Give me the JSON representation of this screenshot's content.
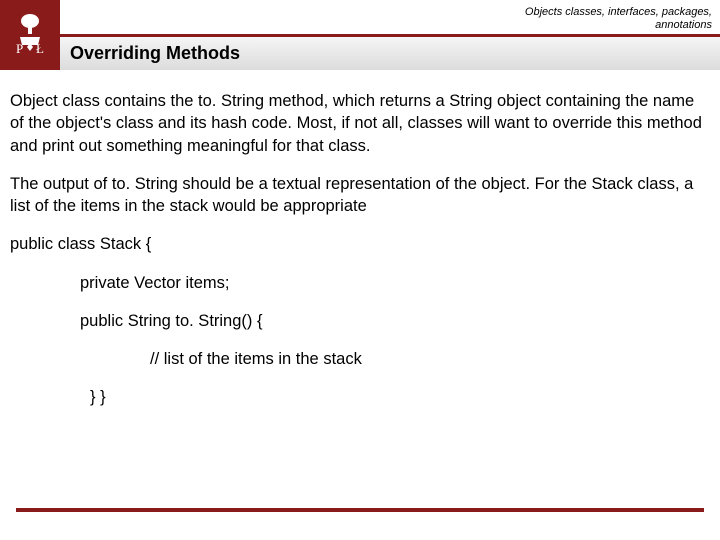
{
  "colors": {
    "accent": "#8a1b1b"
  },
  "header": {
    "logo_letters": {
      "left": "P",
      "right": "Ł"
    },
    "breadcrumb_line1": "Objects classes, interfaces, packages,",
    "breadcrumb_line2": "annotations",
    "title": "Overriding Methods"
  },
  "body": {
    "para1": "Object  class contains the to. String method, which returns a String object containing the name of the object's class and its hash code. Most, if not all, classes will want to override this method and print out something meaningful for that class.",
    "para2": "The output of to. String should be a textual representation of the object. For the Stack class, a list of the items in the stack would be appropriate",
    "code": {
      "l1": "public class Stack {",
      "l2": "private Vector items;",
      "l3": "public String to. String() {",
      "l4": "// list of the items in the stack",
      "l5": "} }"
    }
  }
}
